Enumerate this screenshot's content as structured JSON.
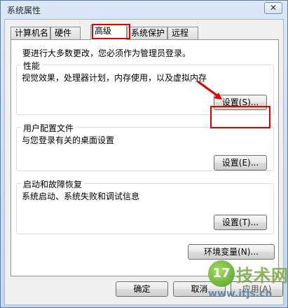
{
  "window": {
    "title": "系统属性",
    "close_glyph": "✕"
  },
  "tabs": [
    {
      "label": "计算机名"
    },
    {
      "label": "硬件"
    },
    {
      "label": "高级",
      "active": true
    },
    {
      "label": "系统保护"
    },
    {
      "label": "远程"
    }
  ],
  "admin_note": "要进行大多数更改，您必须作为管理员登录。",
  "performance": {
    "title": "性能",
    "description": "视觉效果，处理器计划，内存使用，以及虚拟内存",
    "button": "设置(S)..."
  },
  "user_profiles": {
    "title": "用户配置文件",
    "description": "与您登录有关的桌面设置",
    "button": "设置(E)..."
  },
  "startup_recovery": {
    "title": "启动和故障恢复",
    "description": "系统启动、系统失败和调试信息",
    "button": "设置(T)..."
  },
  "env_button": "环境变量(N)...",
  "footer": {
    "ok": "确定",
    "cancel": "取消",
    "apply": "应用(A)"
  },
  "watermark": {
    "logo": "17",
    "name": "技术网",
    "url": "www.itjs.cn"
  },
  "colors": {
    "annotation_red": "#e00000",
    "title_bar": "#c6d9ee"
  }
}
